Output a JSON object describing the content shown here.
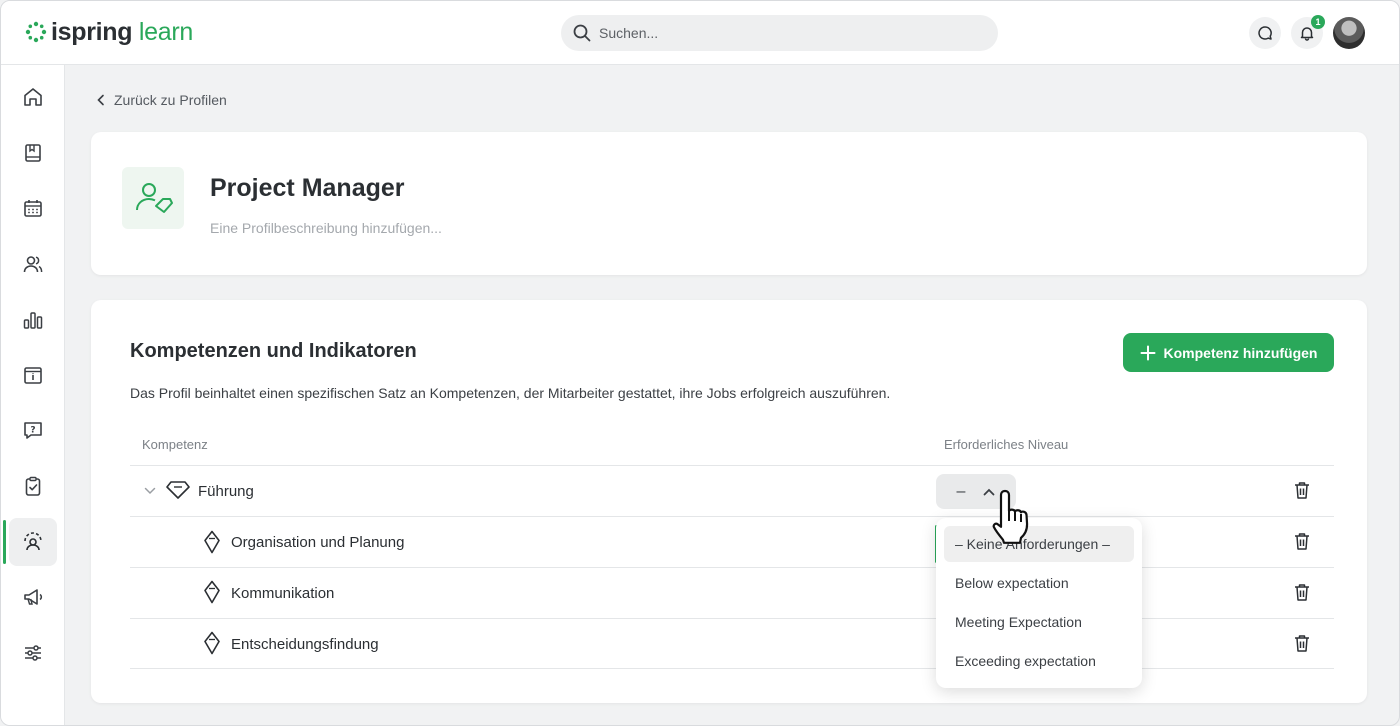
{
  "app": {
    "logo_part1": "ispring",
    "logo_part2": "learn"
  },
  "header": {
    "search_placeholder": "Suchen...",
    "notification_count": "1"
  },
  "sidebar": {
    "items": [
      {
        "icon": "home-icon"
      },
      {
        "icon": "book-icon"
      },
      {
        "icon": "calendar-icon"
      },
      {
        "icon": "users-icon"
      },
      {
        "icon": "reports-icon"
      },
      {
        "icon": "info-icon"
      },
      {
        "icon": "question-icon"
      },
      {
        "icon": "clipboard-icon"
      },
      {
        "icon": "competency-icon",
        "active": true
      },
      {
        "icon": "megaphone-icon"
      },
      {
        "icon": "settings-sliders-icon"
      }
    ]
  },
  "back_link": "Zurück zu Profilen",
  "profile": {
    "title": "Project Manager",
    "description_placeholder": "Eine Profilbeschreibung hinzufügen..."
  },
  "competencies": {
    "title": "Kompetenzen und Indikatoren",
    "description": "Das Profil beinhaltet einen spezifischen Satz an Kompetenzen, der Mitarbeiter gestattet, ihre Jobs erfolgreich auszuführen.",
    "add_button": "Kompetenz hinzufügen",
    "col_competency": "Kompetenz",
    "col_level": "Erforderliches Niveau",
    "rows": [
      {
        "label": "Führung",
        "level": "–"
      },
      {
        "label": "Organisation und Planung"
      },
      {
        "label": "Kommunikation"
      },
      {
        "label": "Entscheidungsfindung"
      }
    ]
  },
  "level_dropdown": {
    "options": [
      "– Keine Anforderungen –",
      "Below expectation",
      "Meeting Expectation",
      "Exceeding expectation"
    ],
    "selected_index": 0
  },
  "colors": {
    "accent": "#2aa85a",
    "background": "#f1f2f3"
  }
}
